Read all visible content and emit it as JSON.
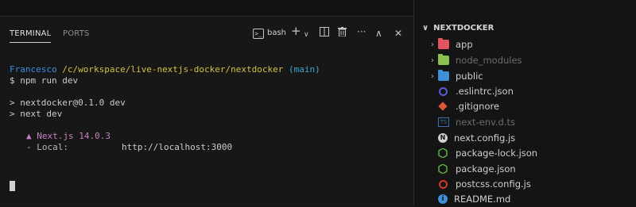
{
  "panel": {
    "tabs": [
      {
        "label": "TERMINAL",
        "active": true
      },
      {
        "label": "PORTS",
        "active": false
      }
    ],
    "toolbar": {
      "profile_label": "bash",
      "icons": [
        "terminal-icon",
        "plus-icon",
        "chevron-down-icon",
        "split-icon",
        "trash-icon",
        "more-icon",
        "chevron-up-icon",
        "close-icon"
      ]
    }
  },
  "terminal": {
    "prompt_user": "Francesco",
    "prompt_path": "/c/workspace/live-nextjs-docker/nextdocker",
    "prompt_branch": "(main)",
    "command": "$ npm run dev",
    "lines": [
      "> nextdocker@0.1.0 dev",
      "> next dev"
    ],
    "next_banner": "Next.js 14.0.3",
    "local_label": "- Local:",
    "local_url": "http://localhost:3000",
    "triangle": "▲"
  },
  "explorer": {
    "title": "NEXTDOCKER",
    "items": [
      {
        "label": "app",
        "type": "folder",
        "color": "#e05561"
      },
      {
        "label": "node_modules",
        "type": "folder",
        "color": "#8cc04f",
        "dim": true
      },
      {
        "label": "public",
        "type": "folder",
        "color": "#3d8fd8"
      },
      {
        "label": ".eslintrc.json",
        "type": "file",
        "icon": "eslint-icon",
        "color": "#5a5ad8"
      },
      {
        "label": ".gitignore",
        "type": "file",
        "icon": "git-icon",
        "color": "#e0563b"
      },
      {
        "label": "next-env.d.ts",
        "type": "file",
        "icon": "typescript-icon",
        "color": "#3a6fb0",
        "dim": true
      },
      {
        "label": "next.config.js",
        "type": "file",
        "icon": "next-icon",
        "color": "#d0d0d0"
      },
      {
        "label": "package-lock.json",
        "type": "file",
        "icon": "node-icon",
        "color": "#5cae45"
      },
      {
        "label": "package.json",
        "type": "file",
        "icon": "node-icon",
        "color": "#5cae45"
      },
      {
        "label": "postcss.config.js",
        "type": "file",
        "icon": "postcss-icon",
        "color": "#d23a2a"
      },
      {
        "label": "README.md",
        "type": "file",
        "icon": "info-icon",
        "color": "#3d8fd8"
      }
    ]
  }
}
